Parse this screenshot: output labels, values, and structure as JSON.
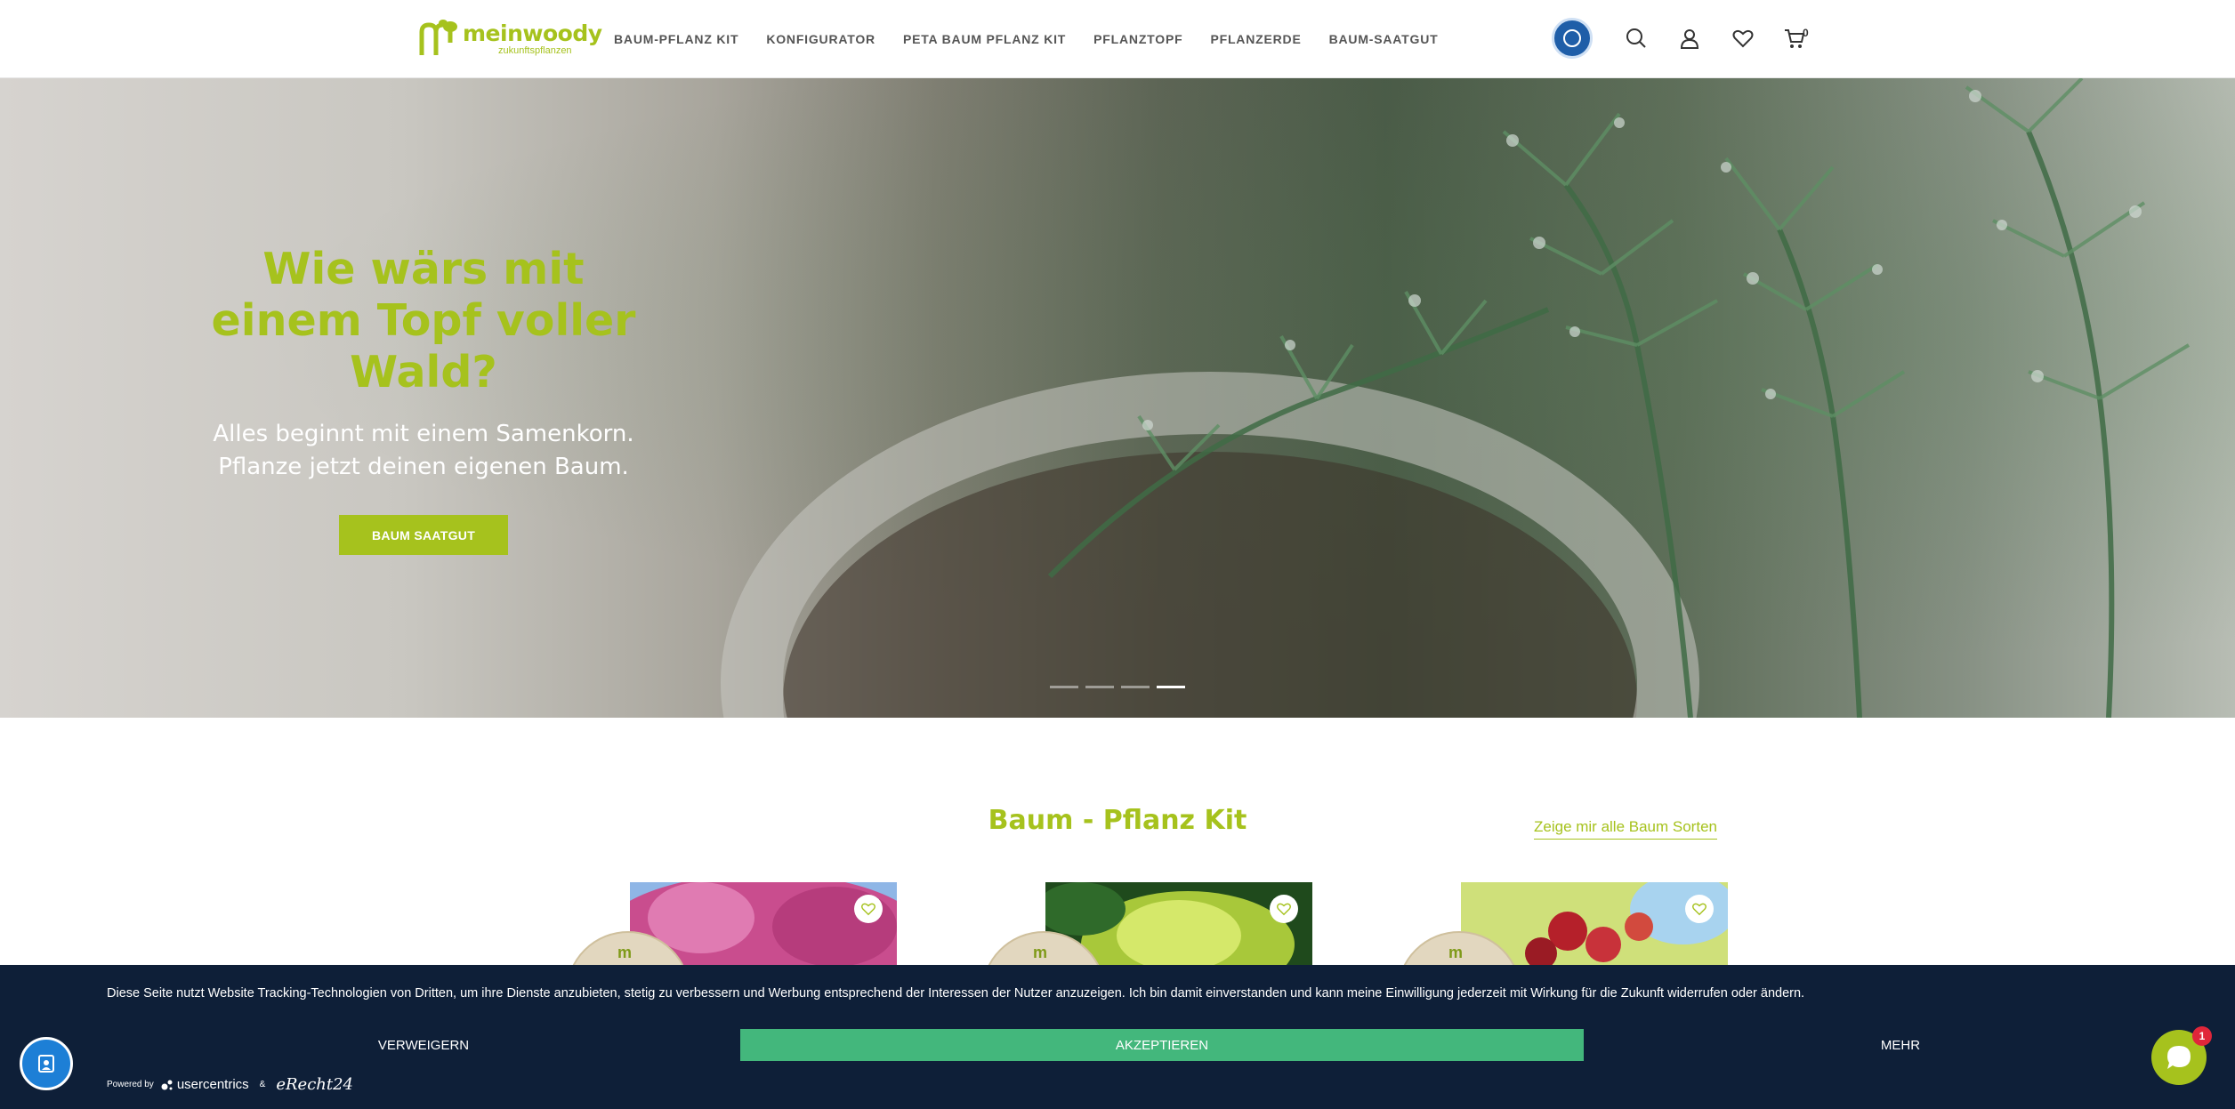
{
  "brand": {
    "name": "meinwoody",
    "tagline": "zukunftspflanzen",
    "accent": "#a6c21d"
  },
  "nav": {
    "items": [
      "BAUM-PFLANZ KIT",
      "KONFIGURATOR",
      "PETA BAUM PFLANZ KIT",
      "PFLANZTOPF",
      "PFLANZERDE",
      "BAUM-SAATGUT"
    ]
  },
  "header_icons": {
    "seal": "blue-angel-seal-icon",
    "search": "search-icon",
    "account": "user-icon",
    "wishlist": "heart-icon",
    "cart": "cart-icon",
    "cart_count": "0"
  },
  "hero": {
    "title": "Wie wärs mit einem Topf voller Wald?",
    "subtitle_line1": "Alles beginnt mit einem Samenkorn.",
    "subtitle_line2": "Pflanze jetzt deinen eigenen Baum.",
    "button_label": "BAUM SAATGUT",
    "slides_total": 4,
    "active_slide": 4
  },
  "section": {
    "title": "Baum - Pflanz Kit",
    "see_all_label": "Zeige mir alle Baum Sorten",
    "cards": [
      {
        "image": "pink-blossom-tree",
        "badge_icon": "meinwoody-badge-icon",
        "heart": "heart-icon"
      },
      {
        "image": "fir-tree-sprig",
        "badge_icon": "meinwoody-badge-icon",
        "heart": "heart-icon"
      },
      {
        "image": "red-apple-tree",
        "badge_icon": "meinwoody-badge-icon",
        "heart": "heart-icon"
      }
    ]
  },
  "cookie_banner": {
    "text": "Diese Seite nutzt Website Tracking-Technologien von Dritten, um ihre Dienste anzubieten, stetig zu verbessern und Werbung entsprechend der Interessen der Nutzer anzuzeigen. Ich bin damit einverstanden und kann meine Einwilligung jederzeit mit Wirkung für die Zukunft widerrufen oder ändern.",
    "deny_label": "VERWEIGERN",
    "accept_label": "AKZEPTIEREN",
    "more_label": "MEHR",
    "powered_label": "Powered by",
    "usercentrics_label": "usercentrics",
    "ampersand": "&",
    "erecht_label": "eRecht24",
    "background": "#0e1f38",
    "accept_color": "#43b77c"
  },
  "widgets": {
    "privacy_icon": "privacy-settings-icon",
    "chat_icon": "chat-icon",
    "chat_badge": "1"
  }
}
